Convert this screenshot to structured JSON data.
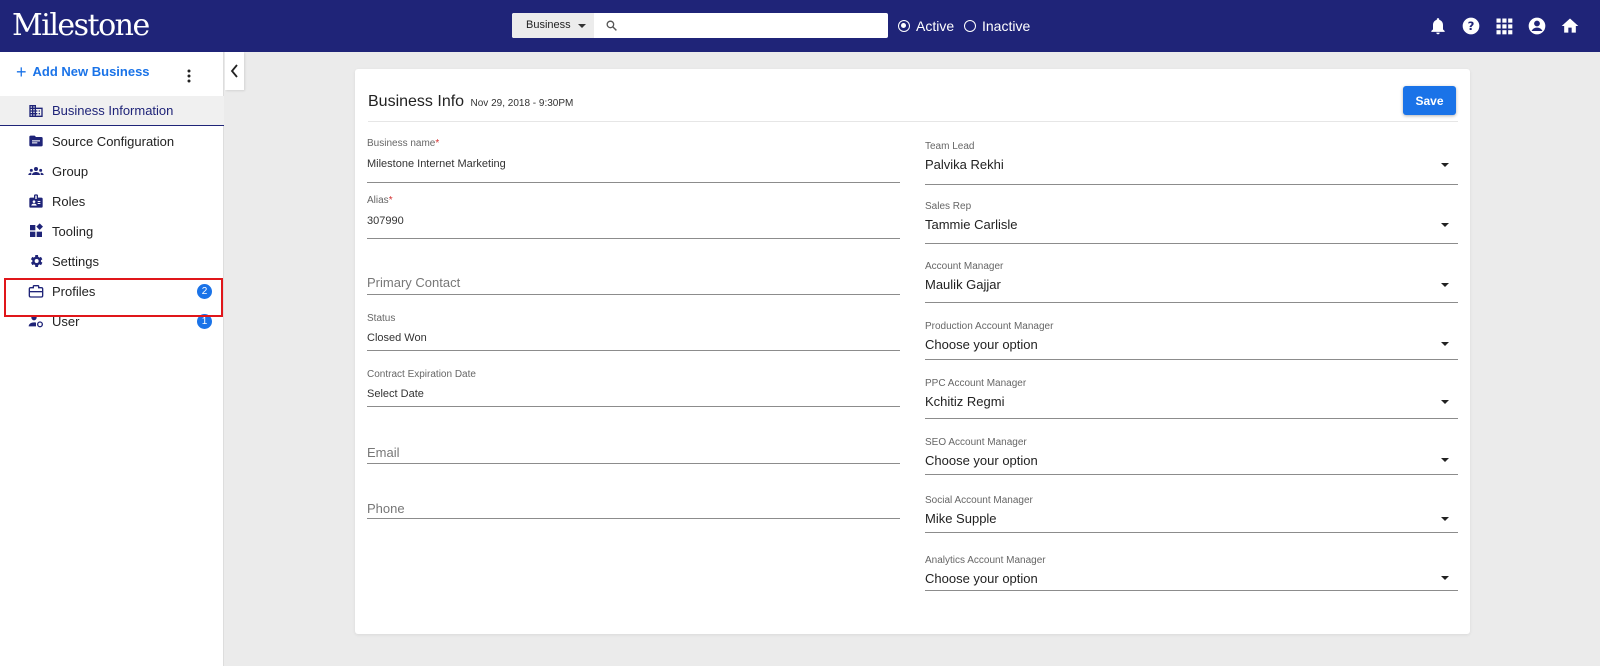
{
  "header": {
    "logo": "Milestone",
    "search_scope": "Business",
    "search_value": "",
    "status_options": [
      {
        "label": "Active",
        "selected": true
      },
      {
        "label": "Inactive",
        "selected": false
      }
    ],
    "icons": [
      "bell-icon",
      "help-icon",
      "apps-grid-icon",
      "account-circle-icon",
      "home-icon"
    ]
  },
  "sidebar": {
    "add_label": "Add New Business",
    "items": [
      {
        "label": "Business Information",
        "icon": "building-icon",
        "active": true
      },
      {
        "label": "Source Configuration",
        "icon": "folder-icon"
      },
      {
        "label": "Group",
        "icon": "group-icon"
      },
      {
        "label": "Roles",
        "icon": "roles-icon"
      },
      {
        "label": "Tooling",
        "icon": "tooling-icon"
      },
      {
        "label": "Settings",
        "icon": "gear-icon"
      },
      {
        "label": "Profiles",
        "icon": "briefcase-icon",
        "badge": "2"
      },
      {
        "label": "User",
        "icon": "user-settings-icon",
        "badge": "1"
      }
    ]
  },
  "card": {
    "title": "Business Info",
    "date": "Nov 29, 2018 - 9:30PM",
    "save_label": "Save",
    "left_fields": {
      "business_name": {
        "label": "Business name",
        "required": "*",
        "value": "Milestone Internet Marketing"
      },
      "alias": {
        "label": "Alias",
        "required": "*",
        "value": "307990"
      },
      "primary_contact": {
        "placeholder": "Primary Contact"
      },
      "status": {
        "label": "Status",
        "value": "Closed Won"
      },
      "contract_expiration": {
        "label": "Contract Expiration Date",
        "value": "Select Date"
      },
      "email": {
        "placeholder": "Email"
      },
      "phone": {
        "placeholder": "Phone"
      }
    },
    "right_fields": {
      "team_lead": {
        "label": "Team Lead",
        "value": "Palvika Rekhi"
      },
      "sales_rep": {
        "label": "Sales Rep",
        "value": "Tammie Carlisle"
      },
      "account_manager": {
        "label": "Account Manager",
        "value": "Maulik Gajjar"
      },
      "production_account_manager": {
        "label": "Production Account Manager",
        "value": "Choose your option"
      },
      "ppc_account_manager": {
        "label": "PPC Account Manager",
        "value": "Kchitiz Regmi"
      },
      "seo_account_manager": {
        "label": "SEO Account Manager",
        "value": "Choose your option"
      },
      "social_account_manager": {
        "label": "Social Account Manager",
        "value": "Mike Supple"
      },
      "analytics_account_manager": {
        "label": "Analytics Account Manager",
        "value": "Choose your option"
      }
    }
  },
  "colors": {
    "topbar": "#1f2478",
    "accent": "#1a73e8",
    "highlight": "#e0161a"
  }
}
